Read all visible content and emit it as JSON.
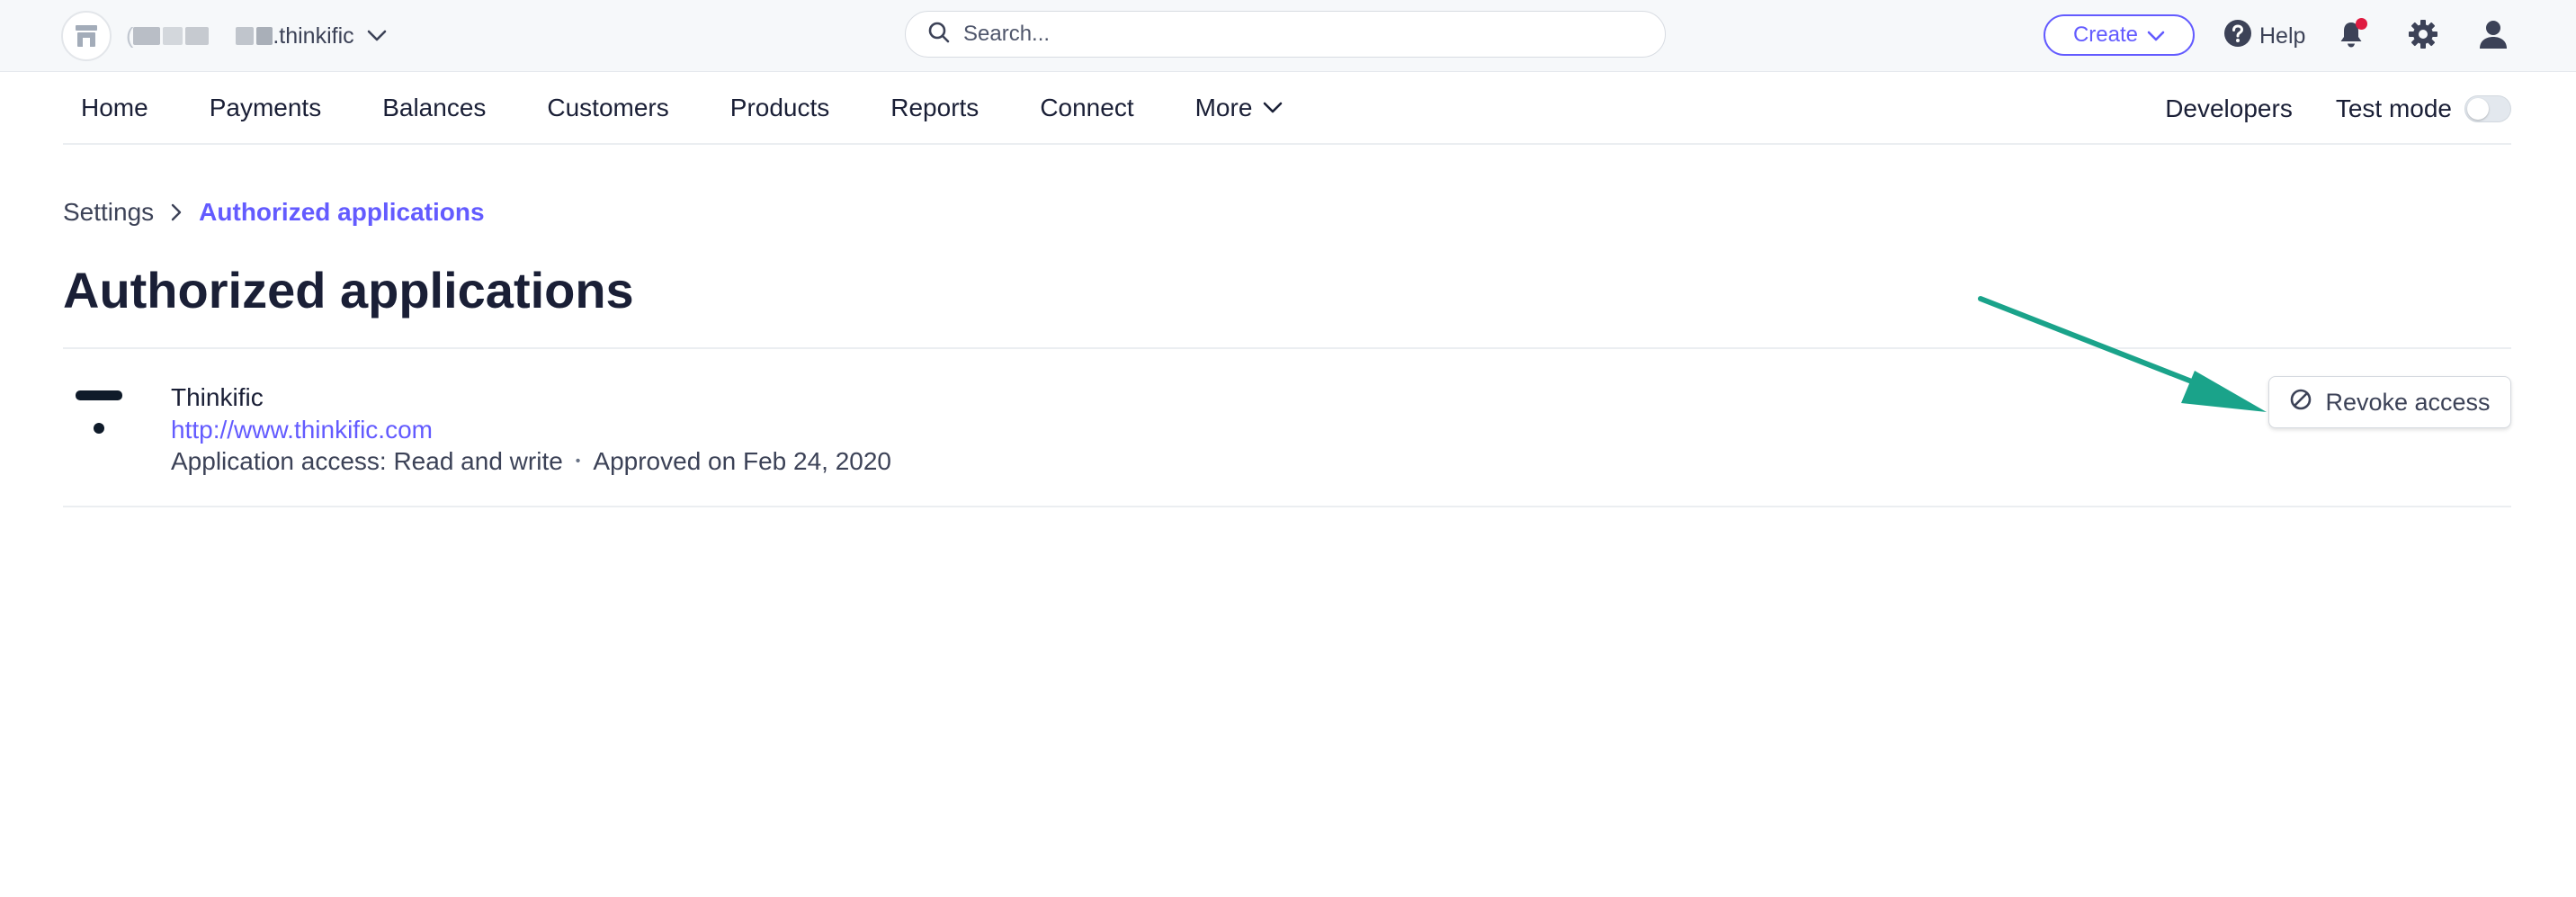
{
  "account": {
    "name_suffix": ".thinkific",
    "name_prefix": "("
  },
  "search": {
    "placeholder": "Search..."
  },
  "topbar": {
    "create_label": "Create",
    "help_label": "Help"
  },
  "nav": {
    "items": [
      {
        "label": "Home"
      },
      {
        "label": "Payments"
      },
      {
        "label": "Balances"
      },
      {
        "label": "Customers"
      },
      {
        "label": "Products"
      },
      {
        "label": "Reports"
      },
      {
        "label": "Connect"
      },
      {
        "label": "More"
      }
    ],
    "developers_label": "Developers",
    "test_mode_label": "Test mode",
    "test_mode_on": false
  },
  "breadcrumb": {
    "parent": "Settings",
    "current": "Authorized applications"
  },
  "page": {
    "title": "Authorized applications"
  },
  "application": {
    "name": "Thinkific",
    "url": "http://www.thinkific.com",
    "access": "Application access: Read and write",
    "separator": "•",
    "approved": "Approved on Feb 24, 2020",
    "revoke_label": "Revoke access"
  },
  "colors": {
    "accent": "#635bff",
    "annotation_arrow": "#1aa38a",
    "notification_dot": "#df1b41"
  },
  "icons": {
    "account": "storefront-icon",
    "search": "search-icon",
    "help": "question-circle-icon",
    "notifications": "bell-icon",
    "settings": "gear-icon",
    "profile": "person-icon",
    "revoke": "cancel-circle-icon"
  }
}
